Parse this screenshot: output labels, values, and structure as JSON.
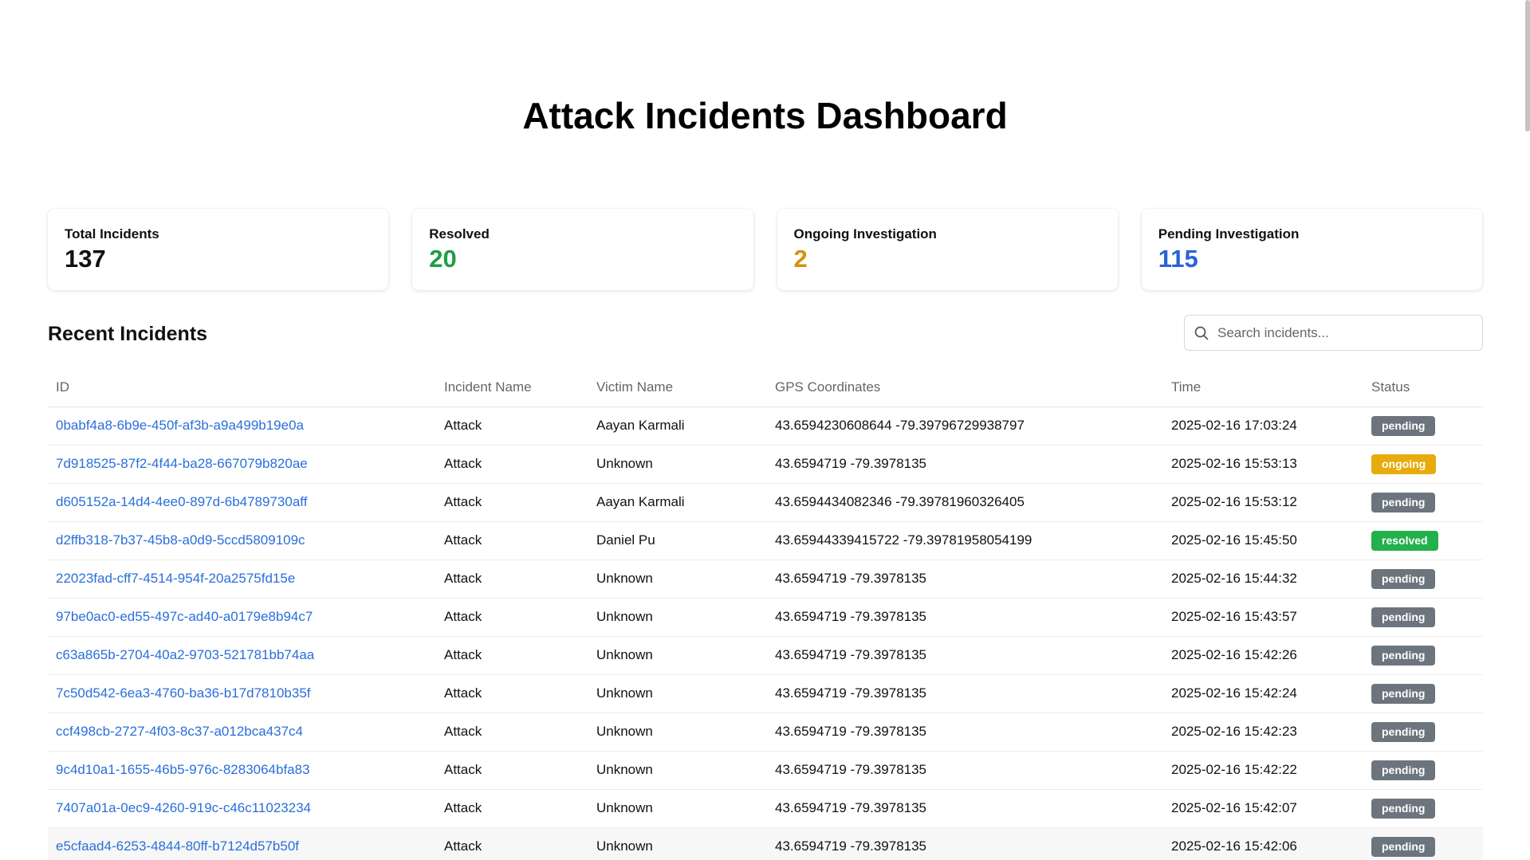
{
  "header": {
    "title": "Attack Incidents Dashboard"
  },
  "stats": [
    {
      "label": "Total Incidents",
      "value": "137",
      "color": "#111111"
    },
    {
      "label": "Resolved",
      "value": "20",
      "color": "#1f9d45"
    },
    {
      "label": "Ongoing Investigation",
      "value": "2",
      "color": "#d4920a"
    },
    {
      "label": "Pending Investigation",
      "value": "115",
      "color": "#2a62d8"
    }
  ],
  "recent": {
    "title": "Recent Incidents",
    "search_placeholder": "Search incidents..."
  },
  "table": {
    "columns": [
      "ID",
      "Incident Name",
      "Victim Name",
      "GPS Coordinates",
      "Time",
      "Status"
    ],
    "rows": [
      {
        "id": "0babf4a8-6b9e-450f-af3b-a9a499b19e0a",
        "incident": "Attack",
        "victim": "Aayan Karmali",
        "gps": "43.6594230608644 -79.39796729938797",
        "time": "2025-02-16 17:03:24",
        "status": "pending"
      },
      {
        "id": "7d918525-87f2-4f44-ba28-667079b820ae",
        "incident": "Attack",
        "victim": "Unknown",
        "gps": "43.6594719 -79.3978135",
        "time": "2025-02-16 15:53:13",
        "status": "ongoing"
      },
      {
        "id": "d605152a-14d4-4ee0-897d-6b4789730aff",
        "incident": "Attack",
        "victim": "Aayan Karmali",
        "gps": "43.6594434082346 -79.39781960326405",
        "time": "2025-02-16 15:53:12",
        "status": "pending"
      },
      {
        "id": "d2ffb318-7b37-45b8-a0d9-5ccd5809109c",
        "incident": "Attack",
        "victim": "Daniel Pu",
        "gps": "43.65944339415722 -79.39781958054199",
        "time": "2025-02-16 15:45:50",
        "status": "resolved"
      },
      {
        "id": "22023fad-cff7-4514-954f-20a2575fd15e",
        "incident": "Attack",
        "victim": "Unknown",
        "gps": "43.6594719 -79.3978135",
        "time": "2025-02-16 15:44:32",
        "status": "pending"
      },
      {
        "id": "97be0ac0-ed55-497c-ad40-a0179e8b94c7",
        "incident": "Attack",
        "victim": "Unknown",
        "gps": "43.6594719 -79.3978135",
        "time": "2025-02-16 15:43:57",
        "status": "pending"
      },
      {
        "id": "c63a865b-2704-40a2-9703-521781bb74aa",
        "incident": "Attack",
        "victim": "Unknown",
        "gps": "43.6594719 -79.3978135",
        "time": "2025-02-16 15:42:26",
        "status": "pending"
      },
      {
        "id": "7c50d542-6ea3-4760-ba36-b17d7810b35f",
        "incident": "Attack",
        "victim": "Unknown",
        "gps": "43.6594719 -79.3978135",
        "time": "2025-02-16 15:42:24",
        "status": "pending"
      },
      {
        "id": "ccf498cb-2727-4f03-8c37-a012bca437c4",
        "incident": "Attack",
        "victim": "Unknown",
        "gps": "43.6594719 -79.3978135",
        "time": "2025-02-16 15:42:23",
        "status": "pending"
      },
      {
        "id": "9c4d10a1-1655-46b5-976c-8283064bfa83",
        "incident": "Attack",
        "victim": "Unknown",
        "gps": "43.6594719 -79.3978135",
        "time": "2025-02-16 15:42:22",
        "status": "pending"
      },
      {
        "id": "7407a01a-0ec9-4260-919c-c46c11023234",
        "incident": "Attack",
        "victim": "Unknown",
        "gps": "43.6594719 -79.3978135",
        "time": "2025-02-16 15:42:07",
        "status": "pending"
      },
      {
        "id": "e5cfaad4-6253-4844-80ff-b7124d57b50f",
        "incident": "Attack",
        "victim": "Unknown",
        "gps": "43.6594719 -79.3978135",
        "time": "2025-02-16 15:42:06",
        "status": "pending"
      }
    ]
  },
  "status_colors": {
    "pending": "#6c757d",
    "ongoing": "#e6ac0c",
    "resolved": "#22b14c"
  }
}
